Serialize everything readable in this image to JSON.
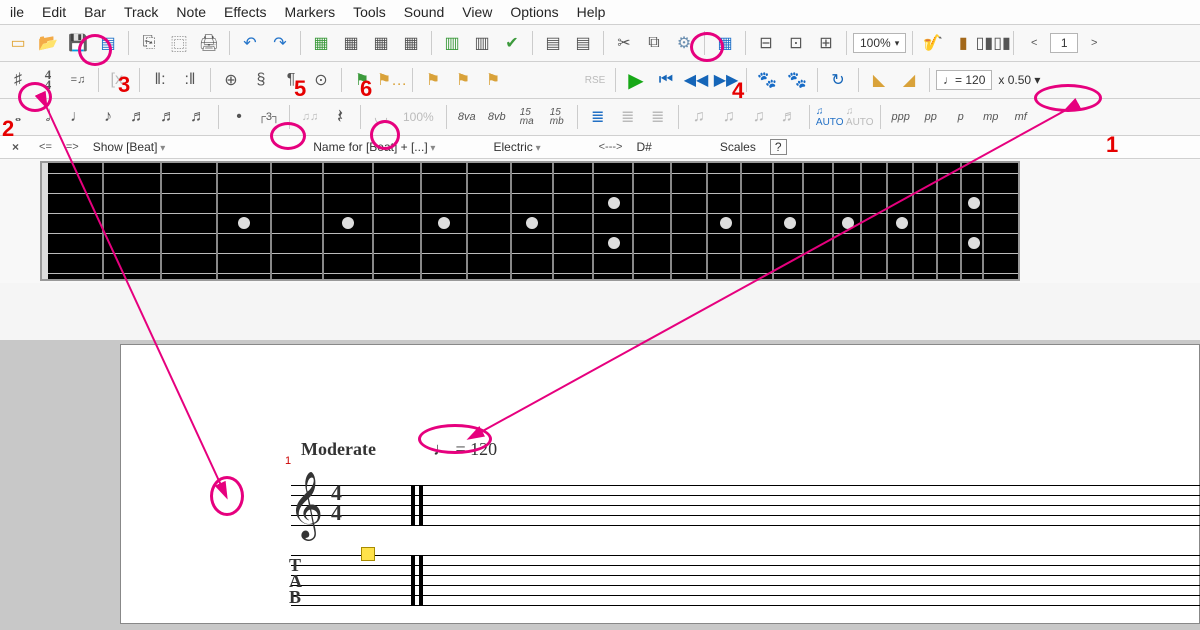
{
  "menu": [
    "ile",
    "Edit",
    "Bar",
    "Track",
    "Note",
    "Effects",
    "Markers",
    "Tools",
    "Sound",
    "View",
    "Options",
    "Help"
  ],
  "toolbar1": {
    "zoom": "100%",
    "page_num": "1"
  },
  "toolbar2": {
    "tempo": "♩= 120",
    "speed": "x 0.50"
  },
  "toolbar3": {
    "percent": "100%",
    "ottava_up": "8va",
    "ottava_down": "8vb",
    "ma15": "15\nma",
    "mb15": "15\nmb",
    "dyn": [
      "ppp",
      "pp",
      "p",
      "mp",
      "mf"
    ]
  },
  "infobar": {
    "lt": "<=",
    "gt": "=>",
    "show": "Show [Beat]",
    "name": "Name for [Beat] + [...]",
    "electric": "Electric",
    "arrows": "<--->",
    "key": "D#",
    "scales": "Scales",
    "help": "?"
  },
  "score": {
    "moderate": "Moderate",
    "tempo": "♩ = 120",
    "timesig_top": "4",
    "timesig_bot": "4",
    "tab_t": "T",
    "tab_a": "A",
    "tab_b": "B",
    "bar_num": "1"
  },
  "annotations": {
    "n1": "1",
    "n2": "2",
    "n3": "3",
    "n4": "4",
    "n5": "5",
    "n6": "6"
  }
}
